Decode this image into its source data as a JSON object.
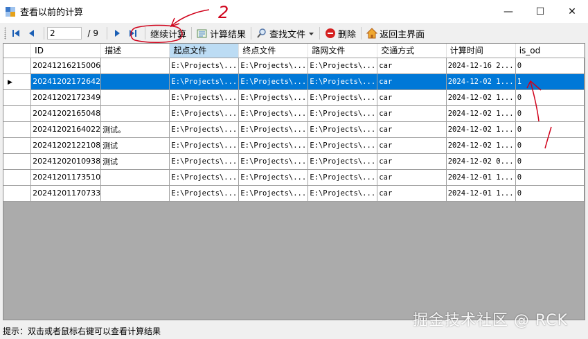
{
  "window": {
    "title": "查看以前的计算",
    "minimize_glyph": "—",
    "maximize_glyph": "☐",
    "close_glyph": "✕"
  },
  "toolbar": {
    "position_value": "2",
    "position_total": "/ 9",
    "continue_label": "继续计算",
    "results_label": "计算结果",
    "find_label": "查找文件",
    "delete_label": "删除",
    "home_label": "返回主界面"
  },
  "grid": {
    "columns": [
      "ID",
      "描述",
      "起点文件",
      "终点文件",
      "路网文件",
      "交通方式",
      "计算时间",
      "is_od"
    ],
    "sorted_column": "起点文件",
    "selected_row": 1,
    "rows": [
      [
        "20241216215006",
        "",
        "E:\\Projects\\...",
        "E:\\Projects\\...",
        "E:\\Projects\\...",
        "car",
        "2024-12-16 2...",
        "0"
      ],
      [
        "20241202172642",
        "",
        "E:\\Projects\\...",
        "E:\\Projects\\...",
        "E:\\Projects\\...",
        "car",
        "2024-12-02 1...",
        "1"
      ],
      [
        "20241202172349",
        "",
        "E:\\Projects\\...",
        "E:\\Projects\\...",
        "E:\\Projects\\...",
        "car",
        "2024-12-02 1...",
        "0"
      ],
      [
        "20241202165048",
        "",
        "E:\\Projects\\...",
        "E:\\Projects\\...",
        "E:\\Projects\\...",
        "car",
        "2024-12-02 1...",
        "0"
      ],
      [
        "20241202164022",
        "测试。",
        "E:\\Projects\\...",
        "E:\\Projects\\...",
        "E:\\Projects\\...",
        "car",
        "2024-12-02 1...",
        "0"
      ],
      [
        "20241202122108",
        "测试",
        "E:\\Projects\\...",
        "E:\\Projects\\...",
        "E:\\Projects\\...",
        "car",
        "2024-12-02 1...",
        "0"
      ],
      [
        "20241202010938",
        "测试",
        "E:\\Projects\\...",
        "E:\\Projects\\...",
        "E:\\Projects\\...",
        "car",
        "2024-12-02 0...",
        "0"
      ],
      [
        "20241201173510",
        "",
        "E:\\Projects\\...",
        "E:\\Projects\\...",
        "E:\\Projects\\...",
        "car",
        "2024-12-01 1...",
        "0"
      ],
      [
        "20241201170733",
        "",
        "E:\\Projects\\...",
        "E:\\Projects\\...",
        "E:\\Projects\\...",
        "car",
        "2024-12-01 1...",
        "0"
      ]
    ]
  },
  "status": {
    "text": "提示：双击或者鼠标右键可以查看计算结果"
  },
  "watermark": "掘金技术社区 @ RCK",
  "annotations": {
    "step_number": "2",
    "annotation_color": "#d0021b"
  },
  "colors": {
    "selection": "#0078d7",
    "sorted_header": "#bcdcf4",
    "grid_background": "#ababab",
    "nav_icon": "#1b5fb5",
    "delete_icon": "#d42020"
  },
  "icons": {
    "first": "first-record-icon",
    "prev": "previous-record-icon",
    "next": "next-record-icon",
    "last": "last-record-icon",
    "results": "results-icon",
    "find": "search-icon",
    "delete": "delete-icon",
    "home": "home-icon"
  }
}
